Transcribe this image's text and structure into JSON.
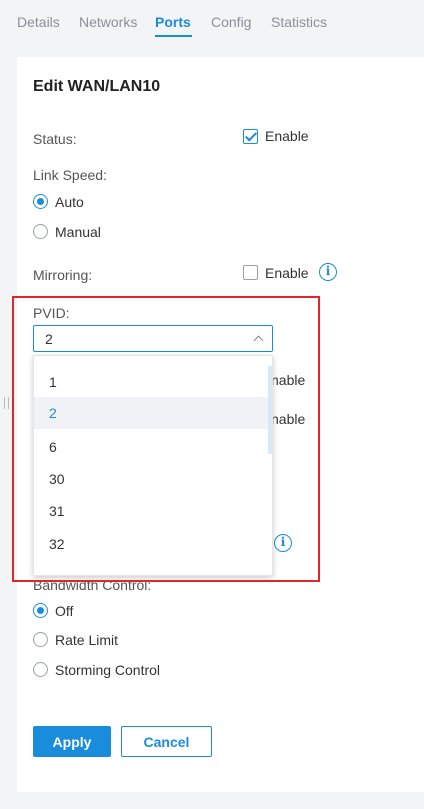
{
  "tabs": [
    {
      "label": "Details"
    },
    {
      "label": "Networks"
    },
    {
      "label": "Ports"
    },
    {
      "label": "Config"
    },
    {
      "label": "Statistics"
    }
  ],
  "active_tab": "Ports",
  "panel": {
    "title": "Edit WAN/LAN10"
  },
  "status": {
    "label": "Status:",
    "option": "Enable",
    "checked": true
  },
  "link_speed": {
    "label": "Link Speed:",
    "options": [
      "Auto",
      "Manual"
    ],
    "selected": "Auto"
  },
  "mirroring": {
    "label": "Mirroring:",
    "option": "Enable",
    "checked": false
  },
  "pvid": {
    "label": "PVID:",
    "value": "2",
    "options": [
      "1",
      "2",
      "6",
      "30",
      "31",
      "32"
    ],
    "selected": "2"
  },
  "hidden_rows": [
    "nable",
    "nable"
  ],
  "bandwidth_control": {
    "label": "Bandwidth Control:",
    "options": [
      "Off",
      "Rate Limit",
      "Storming Control"
    ],
    "selected": "Off"
  },
  "buttons": {
    "apply": "Apply",
    "cancel": "Cancel"
  },
  "colors": {
    "accent": "#1a8cdc",
    "highlight": "#e02727"
  }
}
